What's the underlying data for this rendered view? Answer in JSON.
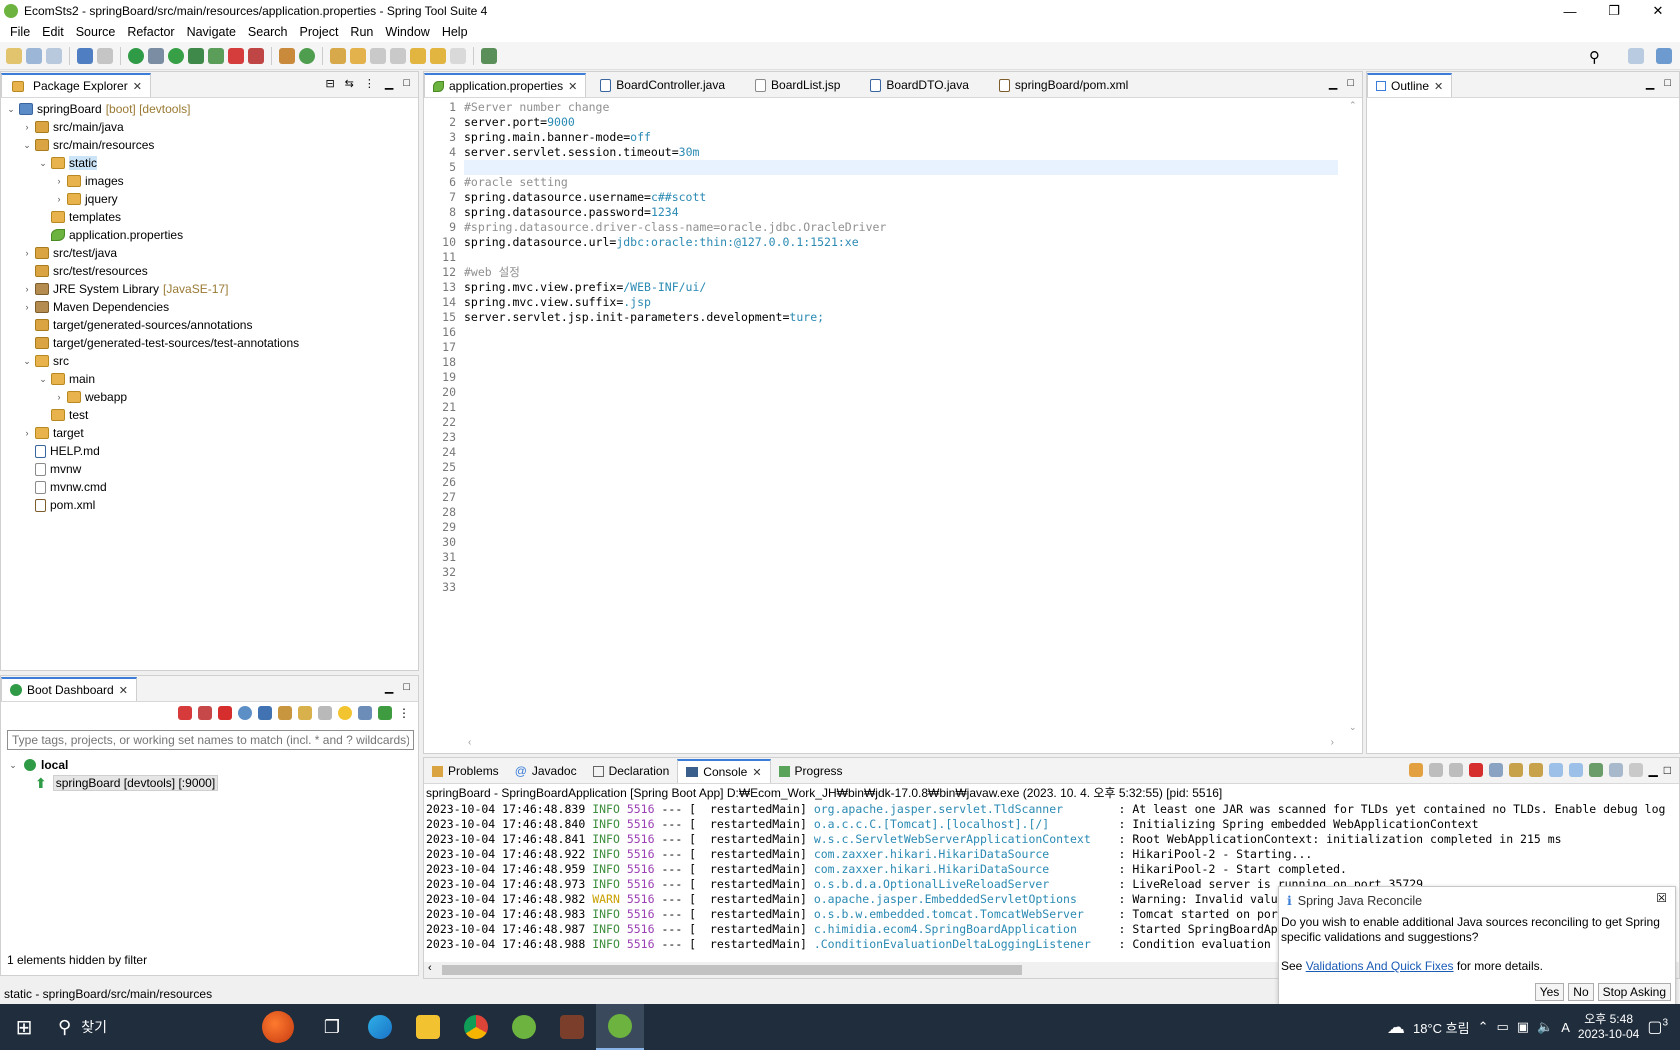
{
  "window": {
    "title": "EcomSts2 - springBoard/src/main/resources/application.properties - Spring Tool Suite 4",
    "controls": [
      "—",
      "❐",
      "✕"
    ]
  },
  "menu": [
    "File",
    "Edit",
    "Source",
    "Refactor",
    "Navigate",
    "Search",
    "Project",
    "Run",
    "Window",
    "Help"
  ],
  "package_explorer": {
    "title": "Package Explorer",
    "items": [
      {
        "label": "springBoard",
        "deco": "[boot] [devtools]"
      },
      {
        "label": "src/main/java"
      },
      {
        "label": "src/main/resources"
      },
      {
        "label": "static"
      },
      {
        "label": "images"
      },
      {
        "label": "jquery"
      },
      {
        "label": "templates"
      },
      {
        "label": "application.properties"
      },
      {
        "label": "src/test/java"
      },
      {
        "label": "src/test/resources"
      },
      {
        "label": "JRE System Library",
        "deco": "[JavaSE-17]"
      },
      {
        "label": "Maven Dependencies"
      },
      {
        "label": "target/generated-sources/annotations"
      },
      {
        "label": "target/generated-test-sources/test-annotations"
      },
      {
        "label": "src"
      },
      {
        "label": "main"
      },
      {
        "label": "webapp"
      },
      {
        "label": "test"
      },
      {
        "label": "target"
      },
      {
        "label": "HELP.md"
      },
      {
        "label": "mvnw"
      },
      {
        "label": "mvnw.cmd"
      },
      {
        "label": "pom.xml"
      }
    ]
  },
  "boot_dashboard": {
    "title": "Boot Dashboard",
    "filter_placeholder": "Type tags, projects, or working set names to match (incl. * and ? wildcards)",
    "group": "local",
    "app": "springBoard [devtools] [:9000]",
    "footer": "1 elements hidden by filter"
  },
  "editor": {
    "tabs": [
      "application.properties",
      "BoardController.java",
      "BoardList.jsp",
      "BoardDTO.java",
      "springBoard/pom.xml"
    ],
    "lines": [
      {
        "n": "1",
        "k": "#Server number change",
        "v": "",
        "c": true
      },
      {
        "n": "2",
        "k": "server.port=",
        "v": "9000"
      },
      {
        "n": "3",
        "k": "spring.main.banner-mode=",
        "v": "off"
      },
      {
        "n": "4",
        "k": "server.servlet.session.timeout=",
        "v": "30m"
      },
      {
        "n": "5",
        "k": "",
        "v": ""
      },
      {
        "n": "6",
        "k": "#oracle setting",
        "v": "",
        "c": true
      },
      {
        "n": "7",
        "k": "spring.datasource.username=",
        "v": "c##scott"
      },
      {
        "n": "8",
        "k": "spring.datasource.password=",
        "v": "1234"
      },
      {
        "n": "9",
        "k": "#spring.datasource.driver-class-name=oracle.jdbc.OracleDriver",
        "v": "",
        "c": true
      },
      {
        "n": "10",
        "k": "spring.datasource.url=",
        "v": "jdbc:oracle:thin:@127.0.0.1:1521:xe"
      },
      {
        "n": "11",
        "k": "",
        "v": ""
      },
      {
        "n": "12",
        "k": "#web 설정",
        "v": "",
        "c": true
      },
      {
        "n": "13",
        "k": "spring.mvc.view.prefix=",
        "v": "/WEB-INF/ui/"
      },
      {
        "n": "14",
        "k": "spring.mvc.view.suffix=",
        "v": ".jsp"
      },
      {
        "n": "15",
        "k": "server.servlet.jsp.init-parameters.development=",
        "v": "ture;"
      },
      {
        "n": "16"
      },
      {
        "n": "17"
      },
      {
        "n": "18"
      },
      {
        "n": "19"
      },
      {
        "n": "20"
      },
      {
        "n": "21"
      },
      {
        "n": "22"
      },
      {
        "n": "23"
      },
      {
        "n": "24"
      },
      {
        "n": "25"
      },
      {
        "n": "26"
      },
      {
        "n": "27"
      },
      {
        "n": "28"
      },
      {
        "n": "29"
      },
      {
        "n": "30"
      },
      {
        "n": "31"
      },
      {
        "n": "32"
      },
      {
        "n": "33"
      }
    ]
  },
  "outline": {
    "title": "Outline"
  },
  "console": {
    "tabs": [
      "Problems",
      "Javadoc",
      "Declaration",
      "Console",
      "Progress"
    ],
    "header": "springBoard - SpringBoardApplication [Spring Boot App] D:₩Ecom_Work_JH₩bin₩jdk-17.0.8₩bin₩javaw.exe  (2023. 10. 4. 오후 5:32:55) [pid: 5516]",
    "lines": [
      {
        "ts": "2023-10-04 17:46:48.839",
        "lvl": "INFO",
        "pid": "5516",
        "thr": "--- [  restartedMain]",
        "logger": "org.apache.jasper.servlet.TldScanner       ",
        "msg": ": At least one JAR was scanned for TLDs yet contained no TLDs. Enable debug logging"
      },
      {
        "ts": "2023-10-04 17:46:48.840",
        "lvl": "INFO",
        "pid": "5516",
        "thr": "--- [  restartedMain]",
        "logger": "o.a.c.c.C.[Tomcat].[localhost].[/]         ",
        "msg": ": Initializing Spring embedded WebApplicationContext"
      },
      {
        "ts": "2023-10-04 17:46:48.841",
        "lvl": "INFO",
        "pid": "5516",
        "thr": "--- [  restartedMain]",
        "logger": "w.s.c.ServletWebServerApplicationContext   ",
        "msg": ": Root WebApplicationContext: initialization completed in 215 ms"
      },
      {
        "ts": "2023-10-04 17:46:48.922",
        "lvl": "INFO",
        "pid": "5516",
        "thr": "--- [  restartedMain]",
        "logger": "com.zaxxer.hikari.HikariDataSource         ",
        "msg": ": HikariPool-2 - Starting..."
      },
      {
        "ts": "2023-10-04 17:46:48.959",
        "lvl": "INFO",
        "pid": "5516",
        "thr": "--- [  restartedMain]",
        "logger": "com.zaxxer.hikari.HikariDataSource         ",
        "msg": ": HikariPool-2 - Start completed."
      },
      {
        "ts": "2023-10-04 17:46:48.973",
        "lvl": "INFO",
        "pid": "5516",
        "thr": "--- [  restartedMain]",
        "logger": "o.s.b.d.a.OptionalLiveReloadServer         ",
        "msg": ": LiveReload server is running on port 35729"
      },
      {
        "ts": "2023-10-04 17:46:48.982",
        "lvl": "WARN",
        "pid": "5516",
        "thr": "--- [  restartedMain]",
        "logger": "o.apache.jasper.EmbeddedServletOptions     ",
        "msg": ": Warning: Invalid value"
      },
      {
        "ts": "2023-10-04 17:46:48.983",
        "lvl": "INFO",
        "pid": "5516",
        "thr": "--- [  restartedMain]",
        "logger": "o.s.b.w.embedded.tomcat.TomcatWebServer    ",
        "msg": ": Tomcat started on port"
      },
      {
        "ts": "2023-10-04 17:46:48.987",
        "lvl": "INFO",
        "pid": "5516",
        "thr": "--- [  restartedMain]",
        "logger": "c.himidia.ecom4.SpringBoardApplication     ",
        "msg": ": Started SpringBoardApp"
      },
      {
        "ts": "2023-10-04 17:46:48.988",
        "lvl": "INFO",
        "pid": "5516",
        "thr": "--- [  restartedMain]",
        "logger": ".ConditionEvaluationDeltaLoggingListener   ",
        "msg": ": Condition evaluation"
      }
    ]
  },
  "status": "static - springBoard/src/main/resources",
  "notification": {
    "title": "Spring Java Reconcile",
    "body": "Do you wish to enable additional Java sources reconciling to get Spring specific validations and suggestions?",
    "see": "See",
    "link": "Validations And Quick Fixes",
    "after": "for more details.",
    "buttons": [
      "Yes",
      "No",
      "Stop Asking"
    ]
  },
  "taskbar": {
    "search": "찾기",
    "weather": "18°C 흐림",
    "time": "오후 5:48",
    "date": "2023-10-04",
    "notifications": "3",
    "ime": "A"
  },
  "colors": {
    "spring_green": "#6db33f",
    "accent": "#3b7dd8"
  }
}
